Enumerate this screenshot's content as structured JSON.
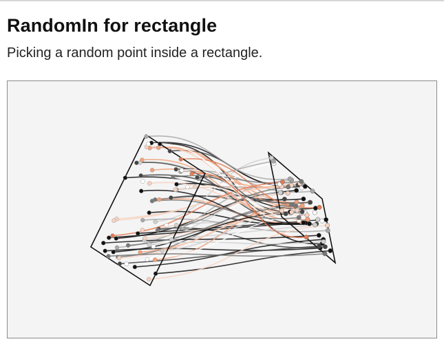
{
  "demo": {
    "title": "RandomIn for rectangle",
    "description": "Picking a random point inside a rectangle."
  },
  "canvas": {
    "background": "#f4f4f4",
    "border_color": "#8a8a8a",
    "shape_stroke": "#111111",
    "point_palette": [
      "#111111",
      "#444444",
      "#777777",
      "#a8a8a8",
      "#d0d0d0",
      "#f7d2c0",
      "#f0a27c",
      "#e57a52",
      "#ffffff"
    ]
  }
}
